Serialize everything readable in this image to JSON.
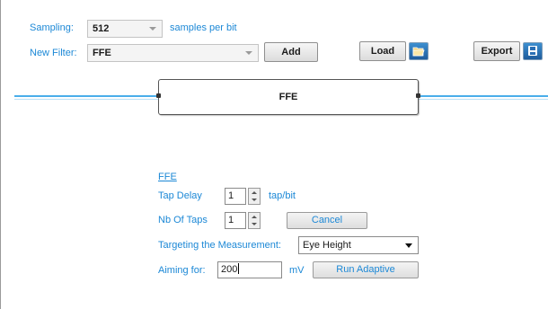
{
  "sampling": {
    "label": "Sampling:",
    "value": "512",
    "unit": "samples per bit"
  },
  "new_filter": {
    "label": "New Filter:",
    "value": "FFE",
    "add_label": "Add"
  },
  "toolbar": {
    "load_label": "Load",
    "load_icon": "folder-open-icon",
    "export_label": "Export",
    "export_icon": "save-icon"
  },
  "chain": {
    "block_label": "FFE"
  },
  "settings": {
    "title": "FFE",
    "tap_delay_label": "Tap Delay",
    "tap_delay_value": "1",
    "tap_delay_unit": "tap/bit",
    "nb_taps_label": "Nb Of Taps",
    "nb_taps_value": "1",
    "cancel_label": "Cancel",
    "target_label": "Targeting the Measurement:",
    "target_value": "Eye Height",
    "aim_label": "Aiming for:",
    "aim_value": "200",
    "aim_unit": "mV",
    "run_label": "Run Adaptive"
  },
  "colors": {
    "accent": "#1c88d6",
    "line": "#4aaeea"
  }
}
